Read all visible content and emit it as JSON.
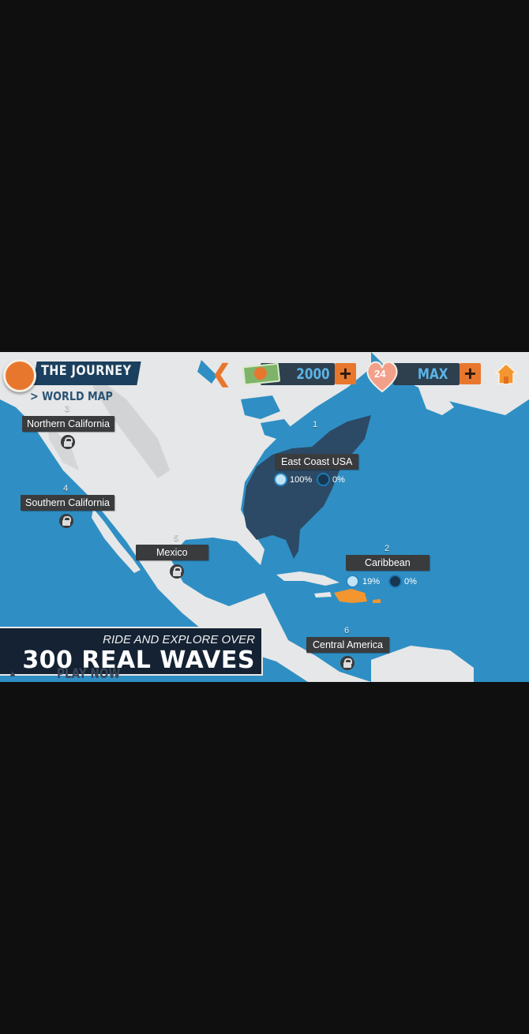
{
  "header": {
    "title": "THE JOURNEY",
    "subtitle": "> WORLD MAP",
    "cash": "2000",
    "lives": "24",
    "energy": "MAX",
    "plus_symbol": "+"
  },
  "icons": {
    "globe": "globe-icon",
    "back": "back-arrow-icon",
    "cash": "cash-icon",
    "heart": "heart-icon",
    "home": "home-icon",
    "lock": "lock-icon",
    "wave": "wave-icon"
  },
  "locations": [
    {
      "num": "3",
      "name": "Northern California",
      "locked": true
    },
    {
      "num": "4",
      "name": "Southern California",
      "locked": true
    },
    {
      "num": "5",
      "name": "Mexico",
      "locked": true
    },
    {
      "num": "1",
      "name": "East Coast USA",
      "locked": false,
      "progress_a": "100%",
      "progress_b": "0%"
    },
    {
      "num": "2",
      "name": "Caribbean",
      "locked": false,
      "progress_a": "19%",
      "progress_b": "0%"
    },
    {
      "num": "6",
      "name": "Central America",
      "locked": true
    }
  ],
  "promo": {
    "line1": "RIDE AND EXPLORE OVER",
    "line2": "300 REAL WAVES"
  },
  "footer": {
    "play_now": "PLAY NOW"
  },
  "colors": {
    "ocean": "#2f8fc4",
    "land": "#e6e7e8",
    "accent": "#e8772e",
    "unlocked_region": "#2c4a66",
    "value_blue": "#5bb4e6"
  }
}
